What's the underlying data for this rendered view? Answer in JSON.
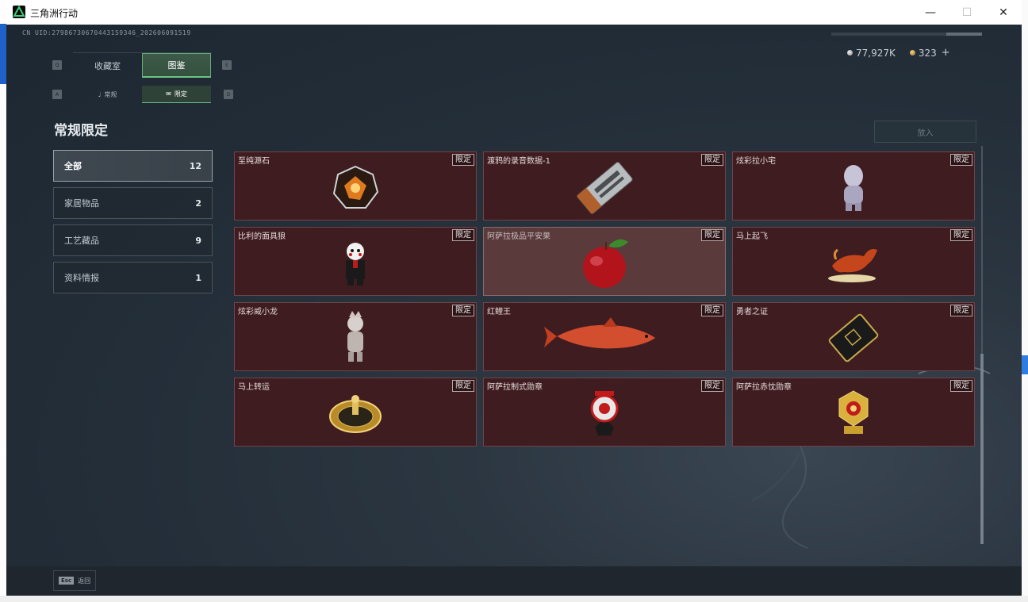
{
  "window": {
    "title": "三角洲行动"
  },
  "window_controls": {
    "minimize": "—",
    "maximize": "☐",
    "close": "✕"
  },
  "header": {
    "uid": "CN UID:2798673067044315934​6_202606091519",
    "currency_silver": "77,927K",
    "currency_gold": "323",
    "currency_plus": "+"
  },
  "tabs_top": {
    "left_key": "Q",
    "right_key": "E",
    "items": [
      {
        "label": "收藏室"
      },
      {
        "label": "图鉴"
      }
    ]
  },
  "tabs_sub": {
    "left_key": "A",
    "right_key": "D",
    "items": [
      {
        "label": "常规"
      },
      {
        "label": "限定"
      }
    ]
  },
  "section_title": "常规限定",
  "categories": [
    {
      "label": "全部",
      "count": "12"
    },
    {
      "label": "家居物品",
      "count": "2"
    },
    {
      "label": "工艺藏品",
      "count": "9"
    },
    {
      "label": "资料情报",
      "count": "1"
    }
  ],
  "put_button": "放入",
  "items": [
    {
      "name": "至纯源石",
      "tag": "限定",
      "art": "gem"
    },
    {
      "name": "渡鸦的录音数据-1",
      "tag": "限定",
      "art": "recorder"
    },
    {
      "name": "炫彩拉小宅",
      "tag": "限定",
      "art": "figurine-silver"
    },
    {
      "name": "比利的面具狼",
      "tag": "限定",
      "art": "puppet"
    },
    {
      "name": "阿萨拉极品平安果",
      "tag": "限定",
      "art": "apple"
    },
    {
      "name": "马上起飞",
      "tag": "限定",
      "art": "horse-red"
    },
    {
      "name": "炫彩威小龙",
      "tag": "限定",
      "art": "figurine-white"
    },
    {
      "name": "红鲤王",
      "tag": "限定",
      "art": "fish"
    },
    {
      "name": "勇者之证",
      "tag": "限定",
      "art": "card"
    },
    {
      "name": "马上转运",
      "tag": "限定",
      "art": "gold-disc"
    },
    {
      "name": "阿萨拉制式勋章",
      "tag": "限定",
      "art": "medal-red"
    },
    {
      "name": "阿萨拉赤忱勋章",
      "tag": "限定",
      "art": "medal-gold"
    }
  ],
  "bottom": {
    "esc_key": "Esc",
    "esc_label": "返回"
  },
  "colors": {
    "accent_green": "#6bc486",
    "card_bg": "#3f1c20",
    "card_border": "#6f4448"
  }
}
